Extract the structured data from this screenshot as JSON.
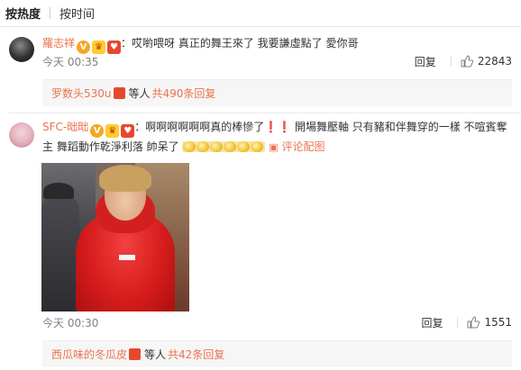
{
  "sort": {
    "hot_label": "按热度",
    "time_label": "按时间"
  },
  "comments": [
    {
      "username": "羅志祥",
      "text": "哎喲喂呀 真正的舞王來了 我要謙虛點了 愛你哥",
      "time": "今天 00:35",
      "reply_label": "回复",
      "like_count": "22843",
      "sub_box": {
        "name": "罗数头530u",
        "text": "等人",
        "count": "共490条回复"
      }
    },
    {
      "username": "SFC-昢昢",
      "text_line1": "啊啊啊啊啊啊真的棒慘了❗❗ 開場舞壓軸 只有豬和伴舞穿的一樣 不喧賓奪",
      "text_line2": "主 舞蹈動作乾淨利落 帥呆了",
      "pic_label": "评论配图",
      "time": "今天 00:30",
      "reply_label": "回复",
      "like_count": "1551",
      "sub_box": {
        "name": "西瓜味的冬瓜皮",
        "text": "等人",
        "count": "共42条回复"
      }
    }
  ],
  "icons": {
    "v_badge": "verified-v-icon",
    "crown_badge": "crown-badge-icon",
    "vip_badge": "vip-badge-icon",
    "like": "thumbs-up-icon",
    "picture": "picture-icon"
  },
  "colors": {
    "accent": "#eb7350",
    "muted": "#808080",
    "sub_bg": "#f6f6f6"
  }
}
